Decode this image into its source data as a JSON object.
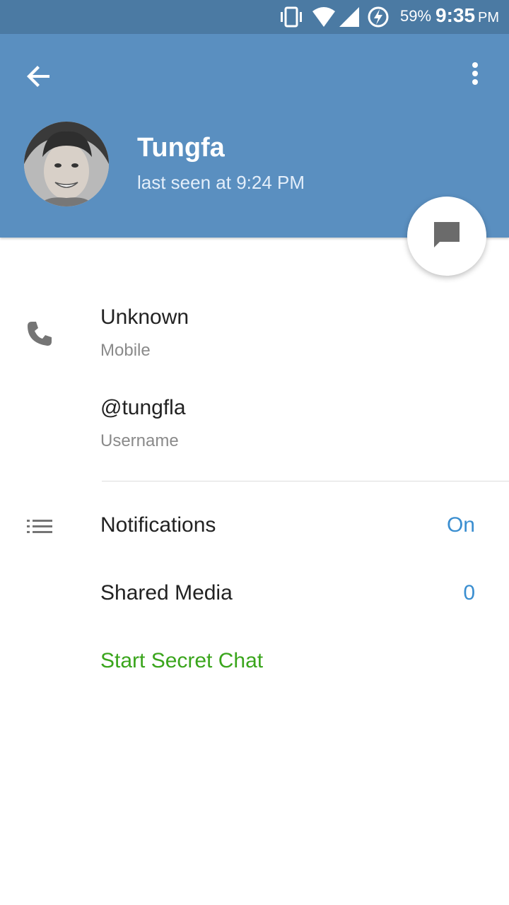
{
  "status_bar": {
    "battery_percent": "59%",
    "time": "9:35",
    "ampm": "PM",
    "icons": [
      "vibrate-icon",
      "wifi-icon",
      "cellular-signal-icon",
      "battery-charging-icon"
    ]
  },
  "header": {
    "name": "Tungfa",
    "status": "last seen at 9:24 PM",
    "back_icon": "arrow-left-icon",
    "menu_icon": "more-vert-icon",
    "fab_icon": "message-icon",
    "color": "#5a8fc0"
  },
  "contact": {
    "phone_value": "Unknown",
    "phone_label": "Mobile",
    "username_value": "@tungfla",
    "username_label": "Username",
    "phone_icon": "phone-icon"
  },
  "settings": {
    "notifications_label": "Notifications",
    "notifications_value": "On",
    "shared_media_label": "Shared Media",
    "shared_media_value": "0",
    "secret_chat_label": "Start Secret Chat",
    "notifications_icon": "list-icon",
    "accent_color": "#3a8ed0",
    "secret_color": "#3aa51c"
  }
}
